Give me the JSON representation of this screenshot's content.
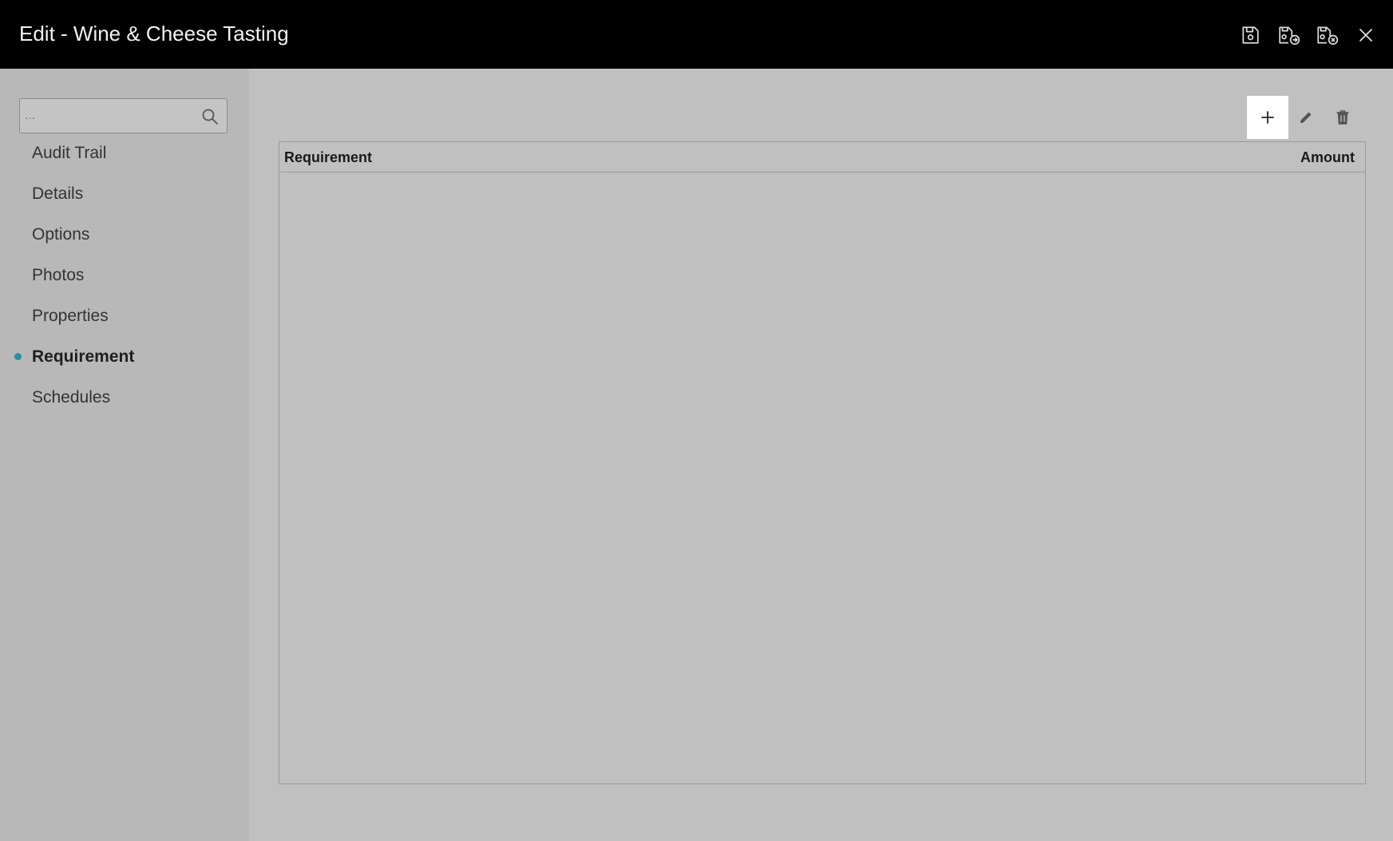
{
  "header": {
    "title": "Edit - Wine & Cheese Tasting",
    "buttons": [
      {
        "icon": "save-icon"
      },
      {
        "icon": "save-and-next-icon"
      },
      {
        "icon": "save-and-close-icon"
      },
      {
        "icon": "close-icon"
      }
    ]
  },
  "sidebar": {
    "search": {
      "placeholder": "...",
      "value": "",
      "icon": "search-icon"
    },
    "items": [
      {
        "label": "Audit Trail",
        "active": false
      },
      {
        "label": "Details",
        "active": false
      },
      {
        "label": "Options",
        "active": false
      },
      {
        "label": "Photos",
        "active": false
      },
      {
        "label": "Properties",
        "active": false
      },
      {
        "label": "Requirement",
        "active": true
      },
      {
        "label": "Schedules",
        "active": false
      }
    ],
    "active_color": "#2a8fa0"
  },
  "main": {
    "toolbar": [
      {
        "icon": "plus-icon",
        "highlighted": true
      },
      {
        "icon": "pencil-icon",
        "highlighted": false
      },
      {
        "icon": "trash-icon",
        "highlighted": false
      }
    ],
    "table": {
      "columns": [
        "Requirement",
        "Amount"
      ],
      "rows": []
    }
  }
}
